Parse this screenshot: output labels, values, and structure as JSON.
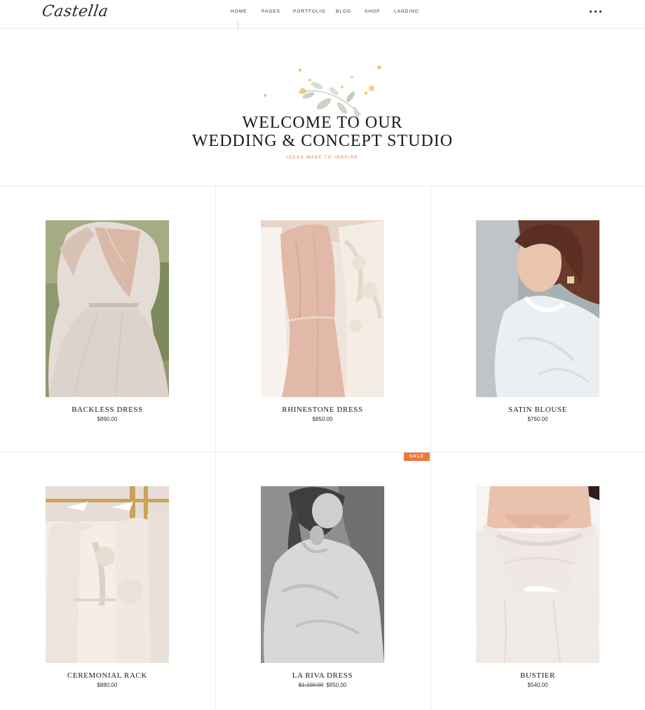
{
  "brand": {
    "logo_text": "Castella"
  },
  "nav": {
    "items": [
      "HOME",
      "PAGES",
      "PORTFOLIO",
      "BLOG",
      "SHOP",
      "LANDING"
    ]
  },
  "header": {
    "more_icon": "ellipsis-horizontal-icon"
  },
  "hero": {
    "title_line1": "WELCOME TO OUR",
    "title_line2": "WEDDING & CONCEPT STUDIO",
    "subtitle": "IDEAS MADE TO INSPIRE",
    "accent_color": "#e8793a",
    "decoration_icon": "leaf-branch-icon"
  },
  "products": [
    {
      "name": "BACKLESS DRESS",
      "price": "$890.00",
      "old_price": "",
      "sale": false
    },
    {
      "name": "RHINESTONE DRESS",
      "price": "$850.00",
      "old_price": "",
      "sale": false
    },
    {
      "name": "SATIN BLOUSE",
      "price": "$760.00",
      "old_price": "",
      "sale": false
    },
    {
      "name": "CEREMONIAL RACK",
      "price": "$880.00",
      "old_price": "",
      "sale": false
    },
    {
      "name": "LA RIVA DRESS",
      "price": "$950.00",
      "old_price": "$1,100.00",
      "sale": true,
      "badge": "SALE"
    },
    {
      "name": "BUSTIER",
      "price": "$540.00",
      "old_price": "",
      "sale": false
    }
  ]
}
